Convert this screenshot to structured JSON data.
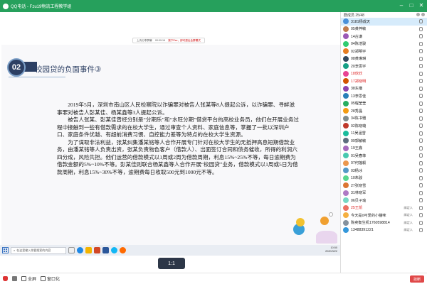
{
  "window": {
    "title": "QQ电话 - Fzu19物流工程教学组",
    "minimize_icon": "minimize-icon",
    "maximize_icon": "maximize-icon",
    "close_icon": "close-icon"
  },
  "share_bar": {
    "left": "上传分享屏幕",
    "time": "00:09:16",
    "right_warn": "按下Esc，即可退出全屏模式"
  },
  "slide": {
    "badge": "02",
    "title": "校园贷的负面事件③",
    "paragraphs": [
      "2019年5月，深圳市南山区人民检察院以诈骗罪对被告人张某等8人提起公诉，以诈骗罪、寻衅滋事罪对被告人彭某佳、杨某鑫等3人提起公诉。",
      "被告人张某、彭某佳曾经分别是“分期乐”和“水旺分期”借贷平台的高校业务员，他们在开展业务过程中接触到一些有借款需求的在校大学生，通过审查个人资料、家庭信息等，掌握了一批以深圳户口、家庭条件优越、有超前消费习惯、自控能力差等为特点的在校大学生资源。",
      "为了谋取非法利益，张某纠集潘某铭等人合作开展专门针对在校大学生的无抵押高息短期借款业务，由潘某铭等人负责出资，张某负责物色客户（借款人）、出面签订合同和债务催收，所得的利润六四分成，风险共担。他们运营的借款模式以1周或2周为借款周期，利息15%~25%不等，每日逾期费为借款金额的5%~10%不等。彭某佳则联合杨某鑫等人合作开展“校园贷”业务，借款模式以1周或5日为借款周期，利息15%~30%不等，逾期费每日收取500元到1000元不等。"
    ]
  },
  "taskbar": {
    "search_placeholder": "在这里输入你要搜索的内容",
    "clock_time": "10:50",
    "clock_date": "2020/3/22"
  },
  "zoom": {
    "label": "1:1"
  },
  "bottom_toolbar": {
    "items": [
      "",
      "",
      "全屏",
      "窗口化"
    ],
    "hangup": "挂断"
  },
  "sidebar": {
    "header": "群成员 25/48",
    "members": [
      {
        "name": "3181杨成天",
        "status": "",
        "color": "#4a90d9"
      },
      {
        "name": "05黄梓敏",
        "status": "",
        "color": "#c07b4c"
      },
      {
        "name": "14古谦",
        "status": "",
        "color": "#9b59b6"
      },
      {
        "name": "04陈浩骏",
        "status": "",
        "color": "#2ecc71"
      },
      {
        "name": "02郑明宇",
        "status": "",
        "color": "#e67e22"
      },
      {
        "name": "08黄琳琳",
        "status": "",
        "color": "#34495e"
      },
      {
        "name": "20李思宇",
        "status": "",
        "color": "#16a085"
      },
      {
        "name": "18欣欣",
        "status": "",
        "color": "#e84393",
        "red": true
      },
      {
        "name": "17郑晓明",
        "status": "",
        "color": "#d35400",
        "red": true
      },
      {
        "name": "38东楷",
        "status": "",
        "color": "#8e44ad"
      },
      {
        "name": "13李思佳",
        "status": "",
        "color": "#2980b9"
      },
      {
        "name": "05程莹莹",
        "status": "",
        "color": "#27ae60"
      },
      {
        "name": "28秀晶",
        "status": "",
        "color": "#f39c12"
      },
      {
        "name": "34陈书雅",
        "status": "",
        "color": "#7f8c8d"
      },
      {
        "name": "02陈晓璐",
        "status": "",
        "color": "#c0392b"
      },
      {
        "name": "11吴涵雪",
        "status": "",
        "color": "#1abc9c"
      },
      {
        "name": "09郭敏敏",
        "status": "",
        "color": "#5d6d7e"
      },
      {
        "name": "19王鑫",
        "status": "",
        "color": "#a569bd"
      },
      {
        "name": "01吴春菲",
        "status": "",
        "color": "#48c9b0"
      },
      {
        "name": "07何莲毅",
        "status": "",
        "color": "#eb984e"
      },
      {
        "name": "03杨冰",
        "status": "",
        "color": "#5499c7"
      },
      {
        "name": "10朱骏",
        "status": "",
        "color": "#58d68d"
      },
      {
        "name": "27张晓雪",
        "status": "",
        "color": "#dc7633"
      },
      {
        "name": "31林晓军",
        "status": "",
        "color": "#af7ac5"
      },
      {
        "name": "06贝子瑜",
        "status": "",
        "color": "#76d7c4"
      },
      {
        "name": "25王凯",
        "status": "绑定人",
        "color": "#ec7063",
        "red": true
      },
      {
        "name": "今天是ò可爱的小猫咪",
        "status": "绑定人",
        "color": "#f5b041"
      },
      {
        "name": "陈奕衡生机1760598814",
        "status": "绑定人",
        "color": "#85929e"
      },
      {
        "name": "13488391221",
        "status": "绑定人",
        "color": "#3498db"
      }
    ],
    "selected_index": 0
  }
}
